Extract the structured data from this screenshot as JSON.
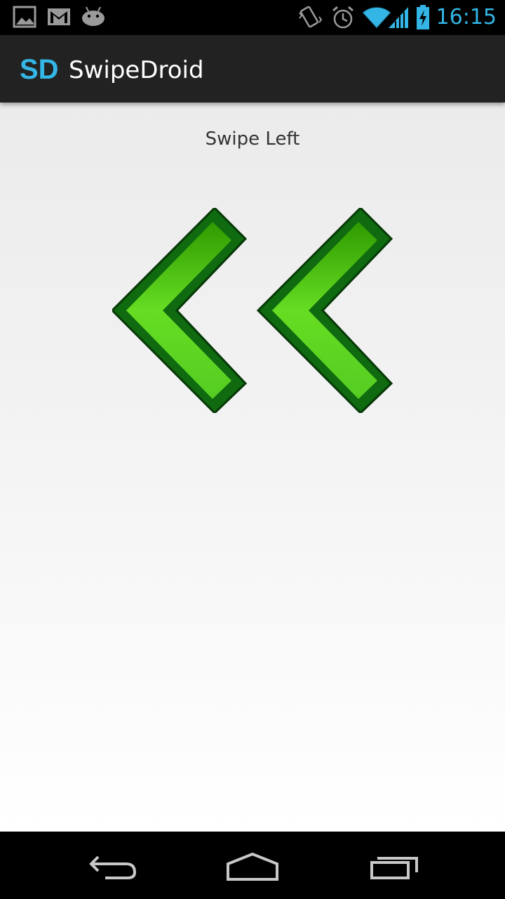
{
  "status_bar": {
    "time": "16:15",
    "icons": [
      "gallery-icon",
      "gmail-icon",
      "android-icon",
      "vibrate-icon",
      "alarm-icon",
      "wifi-icon",
      "signal-icon",
      "battery-charging-icon"
    ]
  },
  "action_bar": {
    "logo": "SD",
    "title": "SwipeDroid"
  },
  "content": {
    "instruction": "Swipe Left",
    "graphic": "double-left-chevron-icon"
  },
  "nav_bar": {
    "buttons": [
      "back-icon",
      "home-icon",
      "recent-apps-icon"
    ]
  },
  "colors": {
    "accent": "#33b5e5",
    "action_bar_bg": "#222222",
    "arrow_light": "#66dd22",
    "arrow_dark": "#117711"
  }
}
